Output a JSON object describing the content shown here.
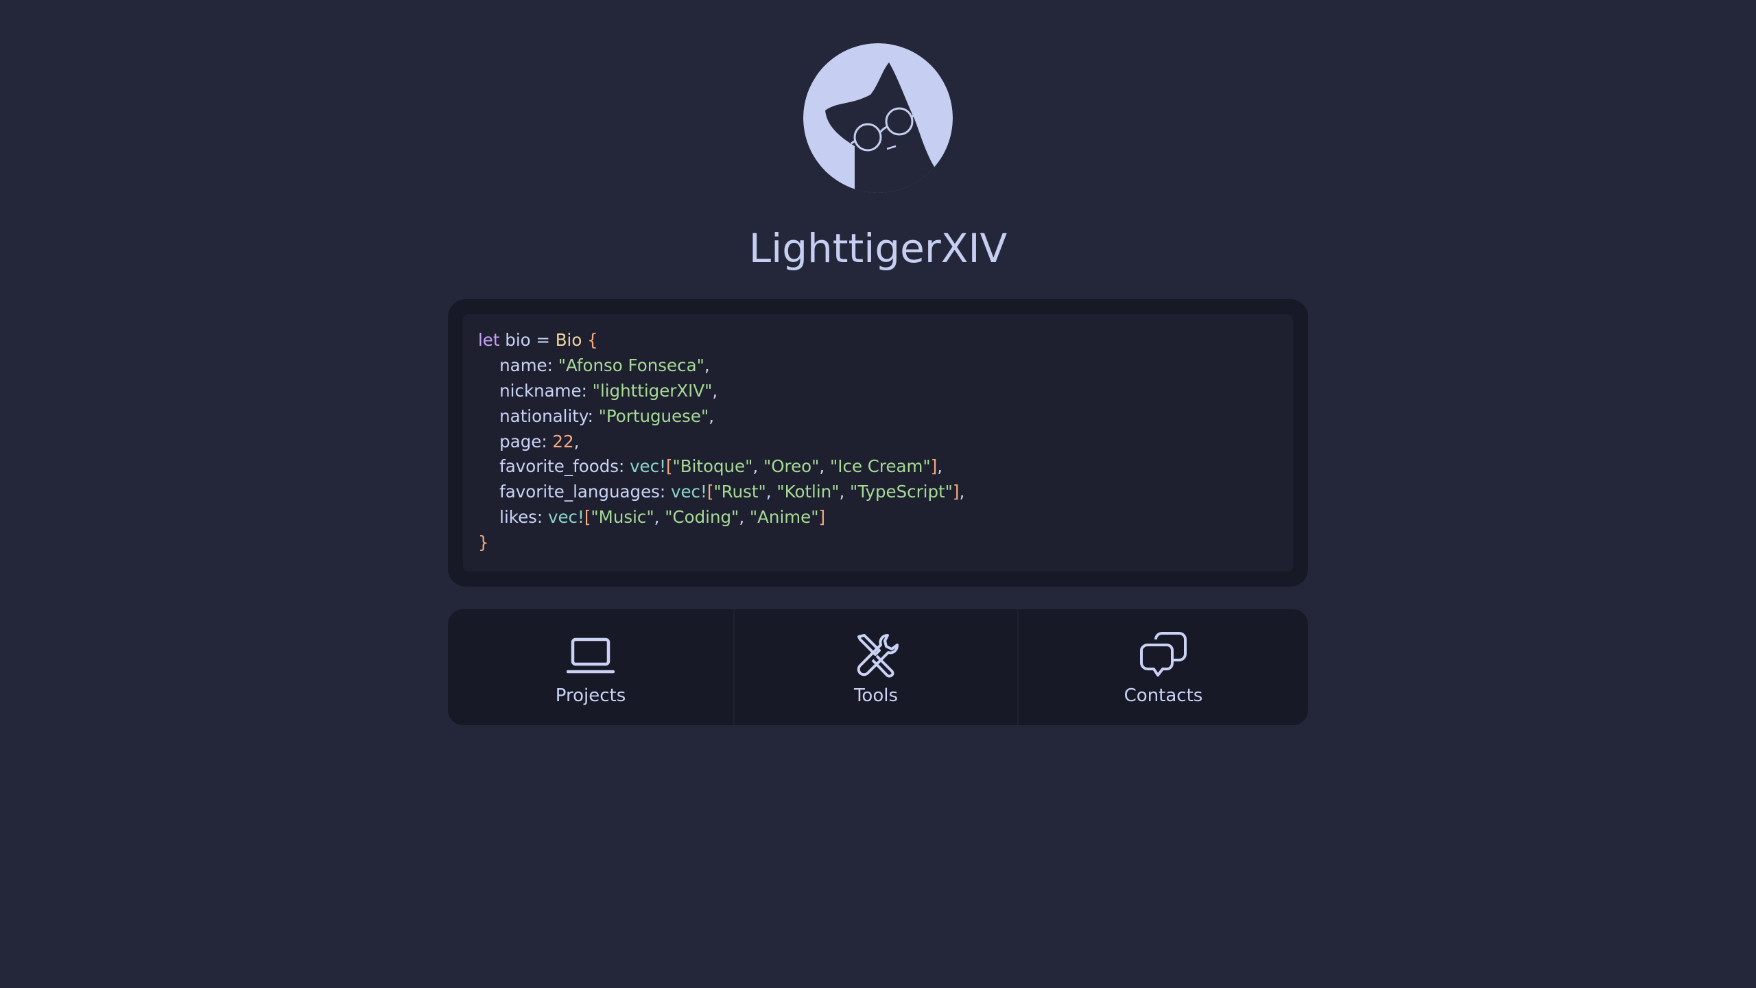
{
  "profile": {
    "username": "LighttigerXIV",
    "avatar_icon": "cat-with-glasses-avatar"
  },
  "bio": {
    "lines": [
      [
        {
          "t": "let",
          "c": "kw"
        },
        {
          "t": " bio = ",
          "c": "pl"
        },
        {
          "t": "Bio",
          "c": "ty"
        },
        {
          "t": " {",
          "c": "br"
        }
      ],
      [
        {
          "t": "    name: ",
          "c": "pl"
        },
        {
          "t": "\"Afonso Fonseca\"",
          "c": "str"
        },
        {
          "t": ",",
          "c": "pl"
        }
      ],
      [
        {
          "t": "    nickname: ",
          "c": "pl"
        },
        {
          "t": "\"lighttigerXIV\"",
          "c": "str"
        },
        {
          "t": ",",
          "c": "pl"
        }
      ],
      [
        {
          "t": "    nationality: ",
          "c": "pl"
        },
        {
          "t": "\"Portuguese\"",
          "c": "str"
        },
        {
          "t": ",",
          "c": "pl"
        }
      ],
      [
        {
          "t": "    page: ",
          "c": "pl"
        },
        {
          "t": "22",
          "c": "num"
        },
        {
          "t": ",",
          "c": "pl"
        }
      ],
      [
        {
          "t": "    favorite_foods: ",
          "c": "pl"
        },
        {
          "t": "vec!",
          "c": "mac"
        },
        {
          "t": "[",
          "c": "br"
        },
        {
          "t": "\"Bitoque\"",
          "c": "str"
        },
        {
          "t": ", ",
          "c": "pl"
        },
        {
          "t": "\"Oreo\"",
          "c": "str"
        },
        {
          "t": ", ",
          "c": "pl"
        },
        {
          "t": "\"Ice Cream\"",
          "c": "str"
        },
        {
          "t": "]",
          "c": "br"
        },
        {
          "t": ",",
          "c": "pl"
        }
      ],
      [
        {
          "t": "    favorite_languages: ",
          "c": "pl"
        },
        {
          "t": "vec!",
          "c": "mac"
        },
        {
          "t": "[",
          "c": "br"
        },
        {
          "t": "\"Rust\"",
          "c": "str"
        },
        {
          "t": ", ",
          "c": "pl"
        },
        {
          "t": "\"Kotlin\"",
          "c": "str"
        },
        {
          "t": ", ",
          "c": "pl"
        },
        {
          "t": "\"TypeScript\"",
          "c": "str"
        },
        {
          "t": "]",
          "c": "br"
        },
        {
          "t": ",",
          "c": "pl"
        }
      ],
      [
        {
          "t": "    likes: ",
          "c": "pl"
        },
        {
          "t": "vec!",
          "c": "mac"
        },
        {
          "t": "[",
          "c": "br"
        },
        {
          "t": "\"Music\"",
          "c": "str"
        },
        {
          "t": ", ",
          "c": "pl"
        },
        {
          "t": "\"Coding\"",
          "c": "str"
        },
        {
          "t": ", ",
          "c": "pl"
        },
        {
          "t": "\"Anime\"",
          "c": "str"
        },
        {
          "t": "]",
          "c": "br"
        }
      ],
      [
        {
          "t": "}",
          "c": "br"
        }
      ]
    ]
  },
  "nav": {
    "items": [
      {
        "label": "Projects",
        "icon": "laptop-icon"
      },
      {
        "label": "Tools",
        "icon": "tools-icon"
      },
      {
        "label": "Contacts",
        "icon": "chat-bubbles-icon"
      }
    ]
  },
  "colors": {
    "background": "#242739",
    "card": "#181926",
    "code_bg": "#1e2030",
    "accent": "#c6cff1",
    "keyword": "#c6a0f6",
    "type": "#eed49f",
    "string": "#a6da95",
    "number": "#f5a97f",
    "macro": "#8bd5ca",
    "text": "#cad3f5"
  }
}
